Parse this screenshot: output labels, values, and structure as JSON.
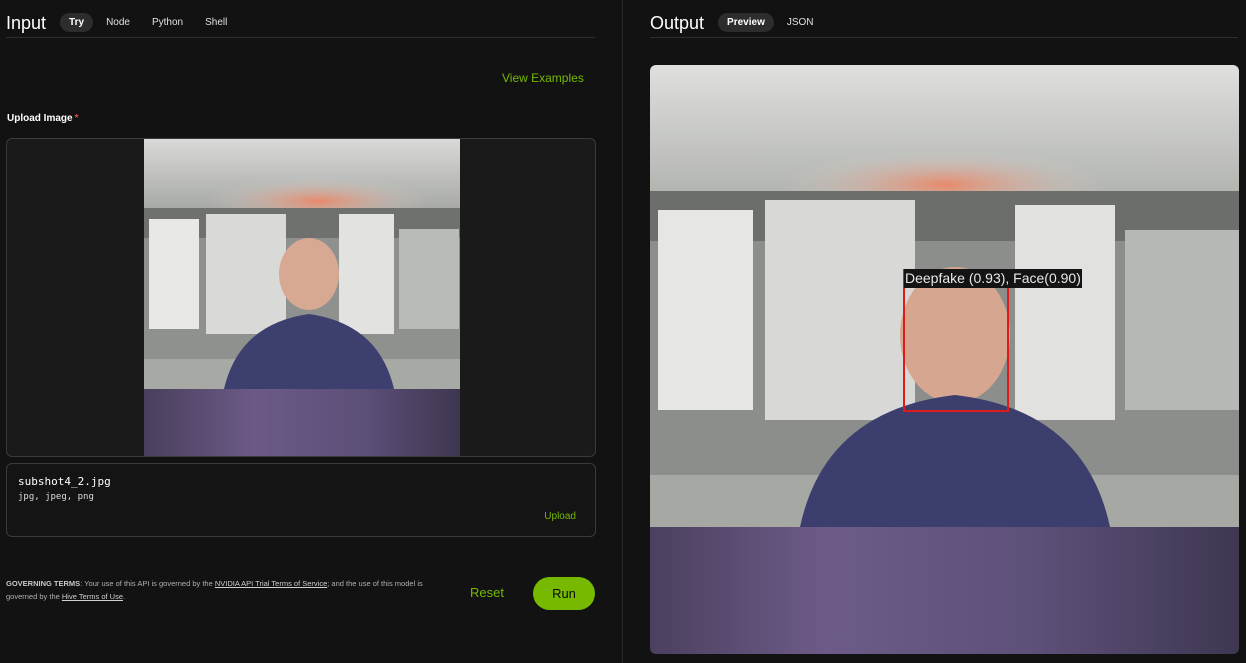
{
  "input": {
    "title": "Input",
    "tabs": [
      {
        "label": "Try",
        "active": true
      },
      {
        "label": "Node",
        "active": false
      },
      {
        "label": "Python",
        "active": false
      },
      {
        "label": "Shell",
        "active": false
      }
    ],
    "view_examples": "View Examples",
    "upload_label": "Upload Image",
    "required_mark": "*",
    "file": {
      "name": "subshot4_2.jpg",
      "types": "jpg, jpeg, png",
      "upload_label": "Upload"
    },
    "terms": {
      "heading": "GOVERNING TERMS",
      "part1": ": Your use of this API is governed by the ",
      "link1": "NVIDIA API Trial Terms of Service",
      "part2": "; and the use of this model is governed by the ",
      "link2": "Hive Terms of Use",
      "part3": "."
    },
    "reset_label": "Reset",
    "run_label": "Run"
  },
  "output": {
    "title": "Output",
    "tabs": [
      {
        "label": "Preview",
        "active": true
      },
      {
        "label": "JSON",
        "active": false
      }
    ],
    "detection_label": "Deepfake (0.93), Face(0.90)"
  },
  "colors": {
    "accent": "#76b900",
    "background": "#121212",
    "detection_box": "#e01b1b",
    "required": "#e04848"
  },
  "icons": []
}
